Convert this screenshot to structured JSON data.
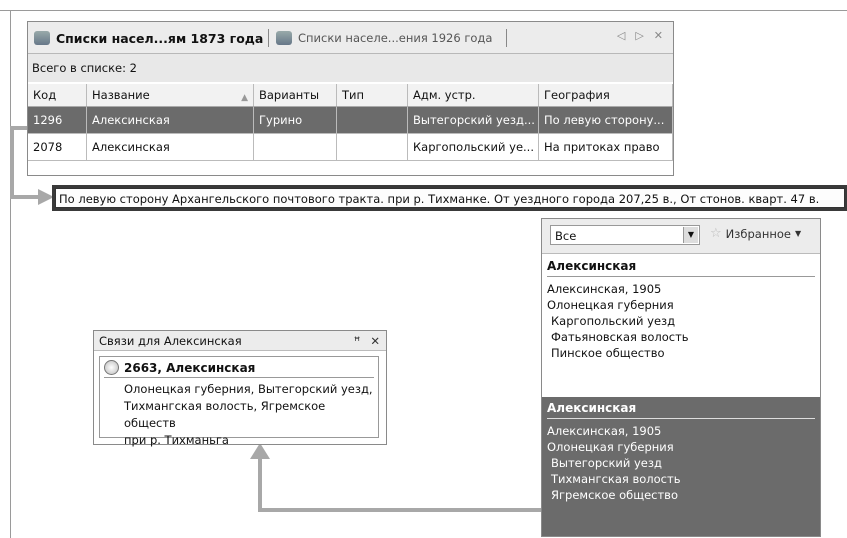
{
  "tabs": [
    {
      "label": "Списки насел...ям 1873 года",
      "active": true
    },
    {
      "label": "Списки населе...ения 1926 года",
      "active": false
    }
  ],
  "tab_controls": {
    "prev": "◁",
    "next": "▷",
    "close": "✕"
  },
  "count_label": "Всего в списке: 2",
  "table": {
    "columns": [
      "Код",
      "Название",
      "Варианты",
      "Тип",
      "Адм. устр.",
      "География"
    ],
    "rows": [
      {
        "selected": true,
        "cells": [
          "1296",
          "Алексинская",
          "Гурино",
          "",
          "Вытегорский уезд...",
          "По левую сторону..."
        ]
      },
      {
        "selected": false,
        "cells": [
          "2078",
          "Алексинская",
          "",
          "",
          "Каргопольский уе...",
          "На притоках право"
        ]
      }
    ]
  },
  "tooltip": "По левую сторону Архангельского почтового тракта. при р. Тихманке. От уездного города 207,25 в., От стонов. кварт. 47 в.",
  "right_panel": {
    "filter_value": "Все",
    "favorites_label": "Избранное",
    "cards": [
      {
        "title": "Алексинская",
        "lines": [
          "Алексинская, 1905",
          "Олонецкая губерния",
          "Каргопольский уезд",
          "Фатьяновская волость",
          "Пинское общество"
        ],
        "selected": false
      },
      {
        "title": "Алексинская",
        "lines": [
          "Алексинская, 1905",
          "Олонецкая губерния",
          "Вытегорский уезд",
          "Тихмангская волость",
          "Ягремское общество"
        ],
        "selected": true
      }
    ]
  },
  "links_window": {
    "title": "Связи для Алексинская",
    "pin": "ꟸ",
    "close": "✕",
    "record_title": "2663, Алексинская",
    "record_lines": [
      "Олонецкая губерния, Вытегорский уезд,",
      "Тихмангская волость, Ягремское обществ",
      "при р. Тихманьга"
    ]
  },
  "colors": {
    "selection": "#6b6b6b",
    "connector": "#a8a8a8"
  }
}
